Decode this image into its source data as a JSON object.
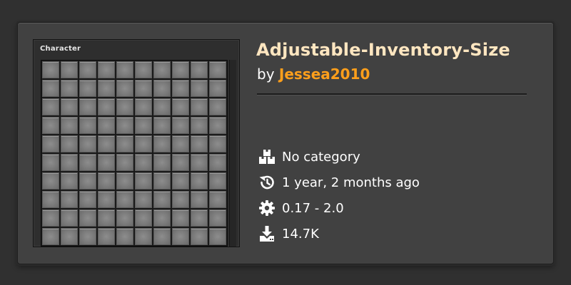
{
  "thumbnail": {
    "window_title": "Character",
    "grid_columns": 10,
    "grid_rows": 10
  },
  "mod": {
    "title": "Adjustable-Inventory-Size",
    "by_prefix": "by",
    "author": "Jessea2010"
  },
  "meta": {
    "category": {
      "icon": "boxes-icon",
      "text": "No category"
    },
    "updated": {
      "icon": "history-icon",
      "text": "1 year, 2 months ago"
    },
    "version": {
      "icon": "gear-icon",
      "text": "0.17 - 2.0"
    },
    "downloads": {
      "icon": "download-icon",
      "text": "14.7K"
    }
  },
  "colors": {
    "title": "#ffe6c0",
    "author": "#ff9f1b",
    "card_bg": "#414141",
    "page_bg": "#313031"
  }
}
